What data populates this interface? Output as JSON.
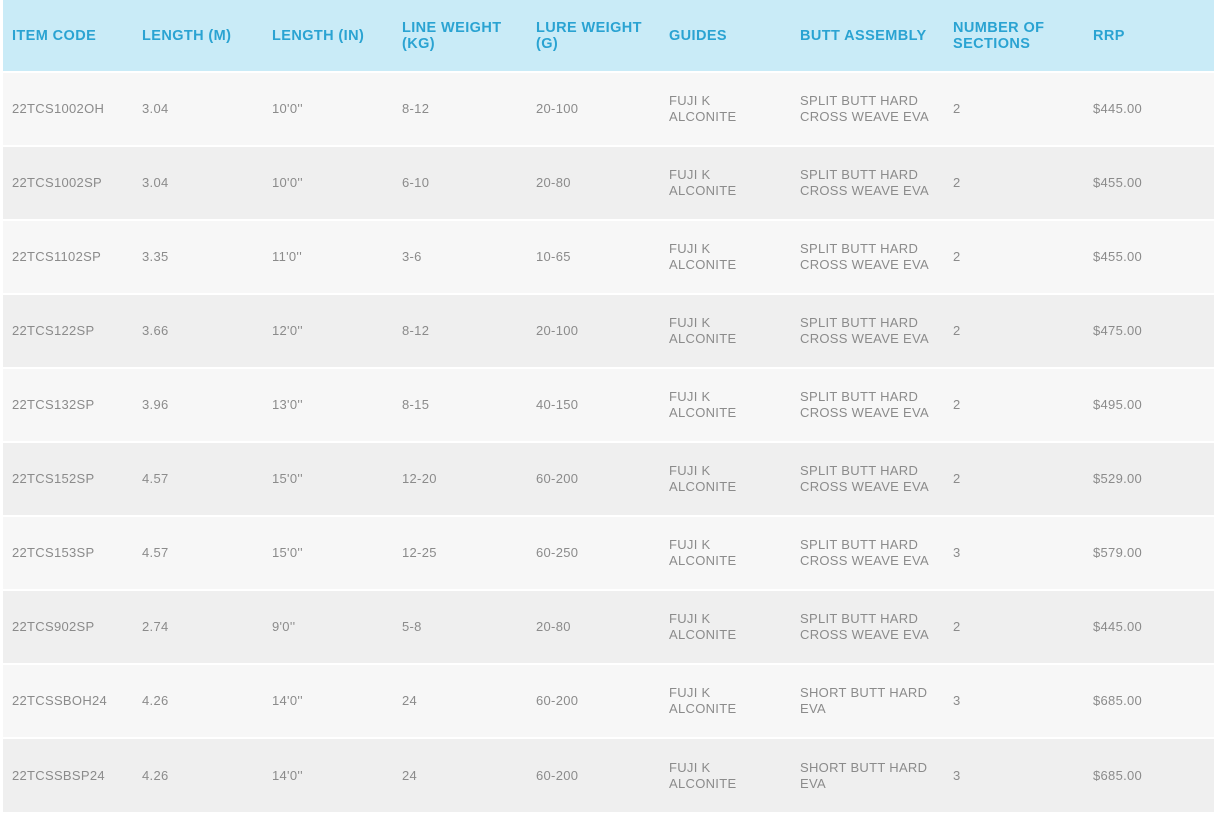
{
  "columns": [
    {
      "label_line1": "ITEM CODE",
      "label_line2": ""
    },
    {
      "label_line1": "LENGTH (M)",
      "label_line2": ""
    },
    {
      "label_line1": "LENGTH (IN)",
      "label_line2": ""
    },
    {
      "label_line1": "LINE WEIGHT",
      "label_line2": "(KG)"
    },
    {
      "label_line1": "LURE WEIGHT",
      "label_line2": "(G)"
    },
    {
      "label_line1": "GUIDES",
      "label_line2": ""
    },
    {
      "label_line1": "BUTT ASSEMBLY",
      "label_line2": ""
    },
    {
      "label_line1": "NUMBER OF",
      "label_line2": "SECTIONS"
    },
    {
      "label_line1": "RRP",
      "label_line2": ""
    }
  ],
  "rows": [
    {
      "item_code": "22TCS1002OH",
      "length_m": "3.04",
      "length_in": "10'0''",
      "line_weight": "8-12",
      "lure_weight": "20-100",
      "guides_1": "FUJI K",
      "guides_2": "ALCONITE",
      "butt_1": "SPLIT BUTT HARD",
      "butt_2": "CROSS WEAVE EVA",
      "sections": "2",
      "rrp": "$445.00"
    },
    {
      "item_code": "22TCS1002SP",
      "length_m": "3.04",
      "length_in": "10'0''",
      "line_weight": "6-10",
      "lure_weight": "20-80",
      "guides_1": "FUJI K",
      "guides_2": "ALCONITE",
      "butt_1": "SPLIT BUTT HARD",
      "butt_2": "CROSS WEAVE EVA",
      "sections": "2",
      "rrp": "$455.00"
    },
    {
      "item_code": "22TCS1102SP",
      "length_m": "3.35",
      "length_in": "11'0''",
      "line_weight": "3-6",
      "lure_weight": "10-65",
      "guides_1": "FUJI K",
      "guides_2": "ALCONITE",
      "butt_1": "SPLIT BUTT HARD",
      "butt_2": "CROSS WEAVE EVA",
      "sections": "2",
      "rrp": "$455.00"
    },
    {
      "item_code": "22TCS122SP",
      "length_m": "3.66",
      "length_in": "12'0''",
      "line_weight": "8-12",
      "lure_weight": "20-100",
      "guides_1": "FUJI K",
      "guides_2": "ALCONITE",
      "butt_1": "SPLIT BUTT HARD",
      "butt_2": "CROSS WEAVE EVA",
      "sections": "2",
      "rrp": "$475.00"
    },
    {
      "item_code": "22TCS132SP",
      "length_m": "3.96",
      "length_in": "13'0''",
      "line_weight": "8-15",
      "lure_weight": "40-150",
      "guides_1": "FUJI K",
      "guides_2": "ALCONITE",
      "butt_1": "SPLIT BUTT HARD",
      "butt_2": "CROSS WEAVE EVA",
      "sections": "2",
      "rrp": "$495.00"
    },
    {
      "item_code": "22TCS152SP",
      "length_m": "4.57",
      "length_in": "15'0''",
      "line_weight": "12-20",
      "lure_weight": "60-200",
      "guides_1": "FUJI K",
      "guides_2": "ALCONITE",
      "butt_1": "SPLIT BUTT HARD",
      "butt_2": "CROSS WEAVE EVA",
      "sections": "2",
      "rrp": "$529.00"
    },
    {
      "item_code": "22TCS153SP",
      "length_m": "4.57",
      "length_in": "15'0''",
      "line_weight": "12-25",
      "lure_weight": "60-250",
      "guides_1": "FUJI K",
      "guides_2": "ALCONITE",
      "butt_1": "SPLIT BUTT HARD",
      "butt_2": "CROSS WEAVE EVA",
      "sections": "3",
      "rrp": "$579.00"
    },
    {
      "item_code": "22TCS902SP",
      "length_m": "2.74",
      "length_in": "9'0''",
      "line_weight": "5-8",
      "lure_weight": "20-80",
      "guides_1": "FUJI K",
      "guides_2": "ALCONITE",
      "butt_1": "SPLIT BUTT HARD",
      "butt_2": "CROSS WEAVE EVA",
      "sections": "2",
      "rrp": "$445.00"
    },
    {
      "item_code": "22TCSSBOH24",
      "length_m": "4.26",
      "length_in": "14'0''",
      "line_weight": "24",
      "lure_weight": "60-200",
      "guides_1": "FUJI K",
      "guides_2": "ALCONITE",
      "butt_1": "SHORT BUTT HARD",
      "butt_2": "EVA",
      "sections": "3",
      "rrp": "$685.00"
    },
    {
      "item_code": "22TCSSBSP24",
      "length_m": "4.26",
      "length_in": "14'0''",
      "line_weight": "24",
      "lure_weight": "60-200",
      "guides_1": "FUJI K",
      "guides_2": "ALCONITE",
      "butt_1": "SHORT BUTT HARD",
      "butt_2": "EVA",
      "sections": "3",
      "rrp": "$685.00"
    }
  ],
  "colors": {
    "header_background": "#c9ebf7",
    "header_text": "#2aa3d2",
    "row_odd": "#f7f7f7",
    "row_even": "#efefef",
    "cell_text": "#8b8b8b"
  }
}
